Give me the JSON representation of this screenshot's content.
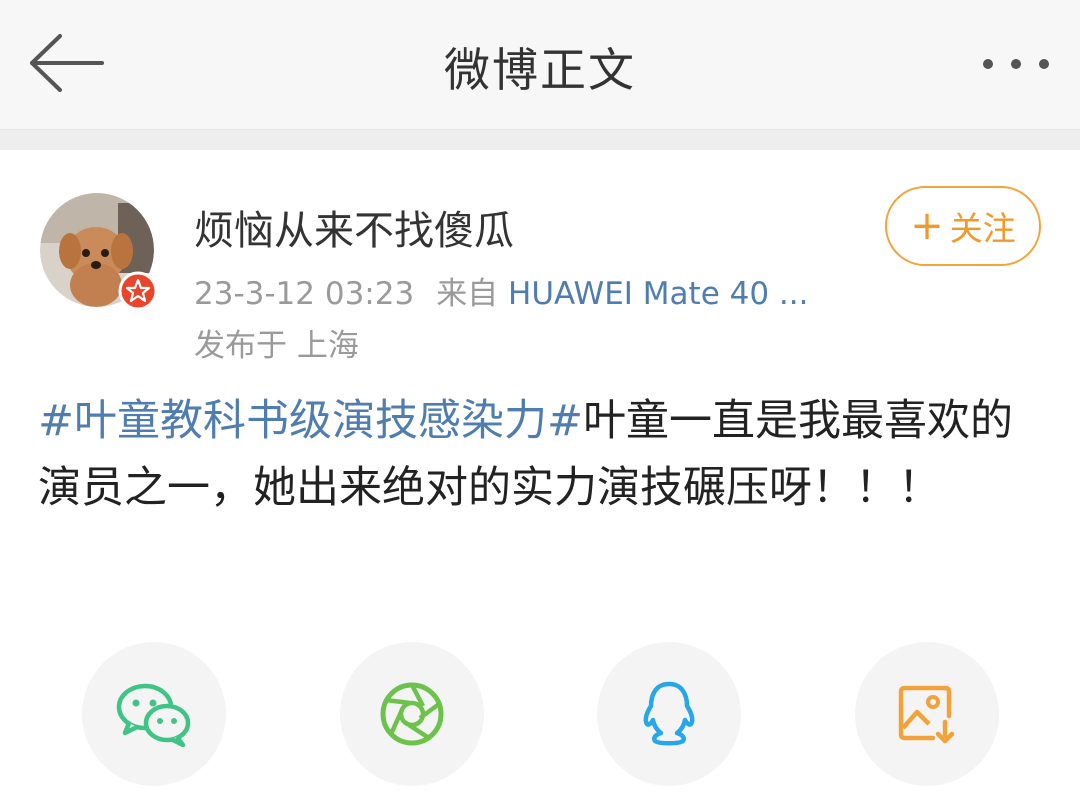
{
  "header": {
    "title": "微博正文",
    "back_icon": "back-arrow-icon",
    "more_icon": "more-dots-icon"
  },
  "post": {
    "author": "烦恼从来不找傻瓜",
    "timestamp": "23-3-12 03:23",
    "source_prefix": "来自",
    "device": "HUAWEI Mate 40 ...",
    "location": "发布于 上海",
    "follow_label": "关注",
    "follow_plus": "+",
    "topic": "#叶童教科书级演技感染力#",
    "text": "叶童一直是我最喜欢的演员之一，她出来绝对的实力演技碾压呀！！！"
  },
  "share": {
    "items": [
      {
        "icon": "wechat-icon",
        "color": "#3fc486"
      },
      {
        "icon": "moments-icon",
        "color": "#6cc24a"
      },
      {
        "icon": "qq-icon",
        "color": "#27a7e7"
      },
      {
        "icon": "save-image-icon",
        "color": "#f2a23b"
      }
    ]
  },
  "colors": {
    "link": "#507daf",
    "accent": "#f09a2b",
    "badge": "#e8452a"
  }
}
